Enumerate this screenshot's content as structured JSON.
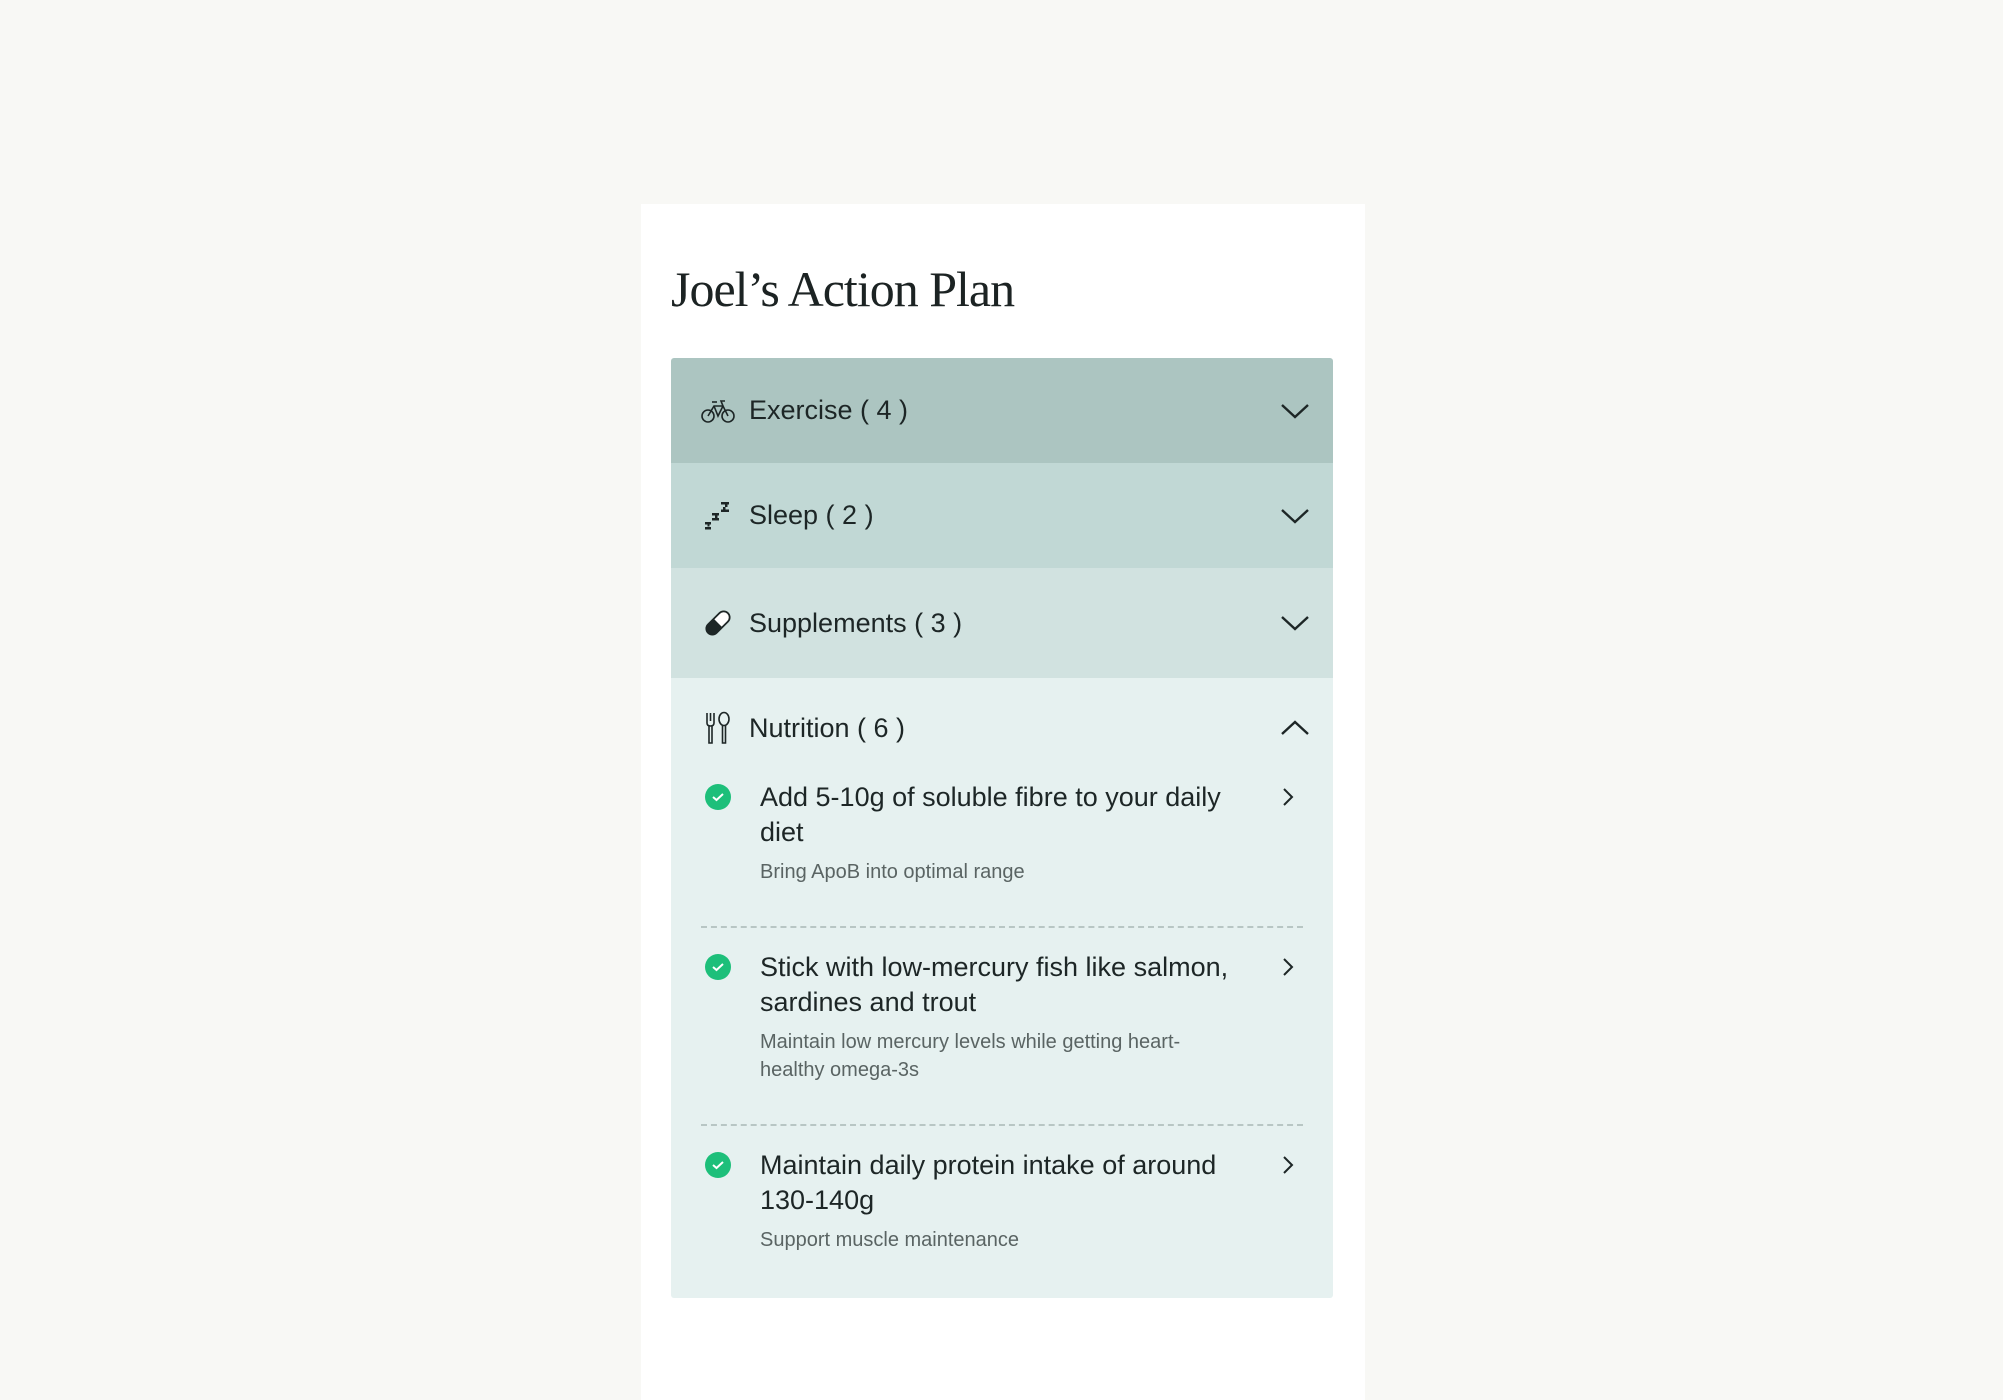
{
  "title": "Joel’s Action Plan",
  "colors": {
    "exercise_bg": "#acc5c1",
    "sleep_bg": "#c1d8d5",
    "supplements_bg": "#d1e2e0",
    "nutrition_bg": "#e6f1f0",
    "check_green": "#1dbf7a"
  },
  "sections": [
    {
      "label": "Exercise ( 4 )",
      "icon": "bicycle-icon",
      "expanded": false
    },
    {
      "label": "Sleep ( 2 )",
      "icon": "zzz-sleep-icon",
      "expanded": false
    },
    {
      "label": "Supplements ( 3 )",
      "icon": "pill-icon",
      "expanded": false
    },
    {
      "label": "Nutrition ( 6 )",
      "icon": "fork-spoon-icon",
      "expanded": true
    }
  ],
  "nutrition_items": [
    {
      "title": "Add 5-10g of soluble fibre to your daily diet",
      "subtitle": "Bring ApoB into optimal range"
    },
    {
      "title": "Stick with low-mercury fish like salmon, sardines and trout",
      "subtitle": "Maintain low mercury levels while getting heart-healthy omega-3s"
    },
    {
      "title": "Maintain daily protein intake of around 130-140g",
      "subtitle": "Support muscle maintenance"
    }
  ]
}
